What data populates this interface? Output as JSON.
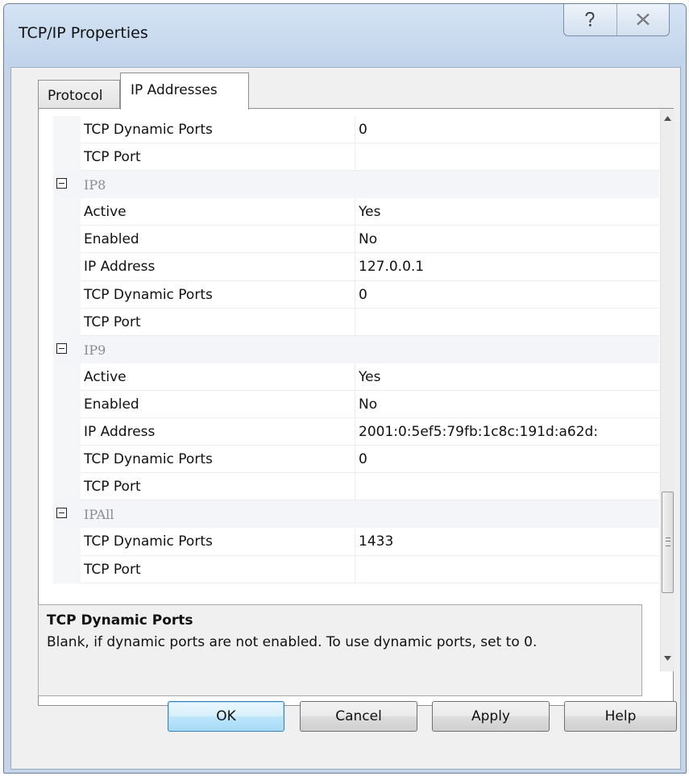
{
  "window": {
    "title": "TCP/IP Properties",
    "help_button": "?",
    "close_button": "X"
  },
  "tabs": [
    {
      "label": "Protocol",
      "selected": false
    },
    {
      "label": "IP Addresses",
      "selected": true
    }
  ],
  "grid": {
    "top_rows": [
      {
        "name": "TCP Dynamic Ports",
        "value": "0"
      },
      {
        "name": "TCP Port",
        "value": ""
      }
    ],
    "ip8": {
      "label": "IP8",
      "rows": [
        {
          "name": "Active",
          "value": "Yes"
        },
        {
          "name": "Enabled",
          "value": "No"
        },
        {
          "name": "IP Address",
          "value": "127.0.0.1"
        },
        {
          "name": "TCP Dynamic Ports",
          "value": "0"
        },
        {
          "name": "TCP Port",
          "value": ""
        }
      ]
    },
    "ip9": {
      "label": "IP9",
      "rows": [
        {
          "name": "Active",
          "value": "Yes"
        },
        {
          "name": "Enabled",
          "value": "No"
        },
        {
          "name": "IP Address",
          "value": "2001:0:5ef5:79fb:1c8c:191d:a62d:"
        },
        {
          "name": "TCP Dynamic Ports",
          "value": "0"
        },
        {
          "name": "TCP Port",
          "value": ""
        }
      ]
    },
    "ipall": {
      "label": "IPAll",
      "rows": [
        {
          "name": "TCP Dynamic Ports",
          "value": "1433"
        },
        {
          "name": "TCP Port",
          "value": ""
        }
      ]
    }
  },
  "description": {
    "title": "TCP Dynamic Ports",
    "text": "Blank, if dynamic ports are not enabled. To use dynamic ports, set to 0."
  },
  "buttons": {
    "ok": "OK",
    "cancel": "Cancel",
    "apply": "Apply",
    "help": "Help"
  },
  "colors": {
    "window_frame": "#c4d5ea",
    "dialog_face": "#f0f0f0",
    "category_text": "#8b8b8b",
    "default_button_border": "#3c7fb1"
  }
}
